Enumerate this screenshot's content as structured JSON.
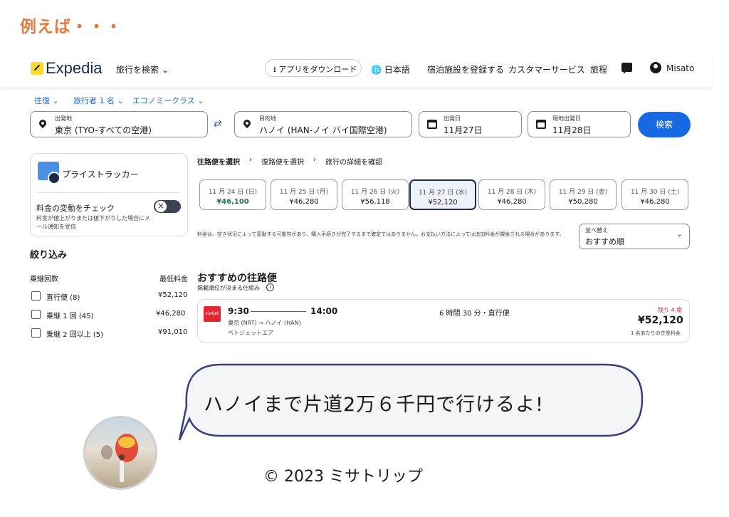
{
  "caption": "例えば・・・",
  "header": {
    "brand": "Expedia",
    "search_travel": "旅行を検索 ⌄",
    "app_download": "⭳ アプリをダウンロード",
    "language": "🌐 日本語",
    "register_property": "宿泊施設を登録する",
    "customer_service": "カスタマーサービス",
    "trips": "旅程",
    "user_name": "Misato"
  },
  "selectors": {
    "trip_type": "往復 ⌄",
    "travelers": "旅行者 1 名 ⌄",
    "cabin": "エコノミークラス ⌄"
  },
  "search": {
    "origin_label": "出発地",
    "origin_value": "東京 (TYO-すべての空港)",
    "destination_label": "目的地",
    "destination_value": "ハノイ (HAN-ノイ バイ国際空港)",
    "depart_label": "出発日",
    "depart_value": "11月27日",
    "return_label": "現地出発日",
    "return_value": "11月28日",
    "search_button": "検索",
    "swap_glyph": "⇄"
  },
  "price_tracker": {
    "title": "プライストラッカー",
    "subtitle": "料金の変動をチェック",
    "description": "料金が値上がりまたは値下がりした場合にメール通知を受信",
    "enabled": false
  },
  "filters": {
    "title": "絞り込み",
    "stops_header": "乗継回数",
    "min_price_header": "最低料金",
    "options": [
      {
        "label": "直行便 (8)",
        "price": "¥52,120"
      },
      {
        "label": "乗継 1 回 (45)",
        "price": "¥46,280"
      },
      {
        "label": "乗継 2 回以上 (5)",
        "price": "¥91,010"
      }
    ]
  },
  "breadcrumbs": {
    "step1": "往路便を選択",
    "step2": "復路便を選択",
    "step3": "旅行の詳細を確認",
    "sep": "›"
  },
  "dates": [
    {
      "date": "11 月 24 日 (日)",
      "price": "¥46,100",
      "lowest": true
    },
    {
      "date": "11 月 25 日 (月)",
      "price": "¥46,280"
    },
    {
      "date": "11 月 26 日 (火)",
      "price": "¥56,118"
    },
    {
      "date": "11 月 27 日 (水)",
      "price": "¥52,120",
      "selected": true
    },
    {
      "date": "11 月 28 日 (木)",
      "price": "¥46,280"
    },
    {
      "date": "11 月 29 日 (金)",
      "price": "¥50,280"
    },
    {
      "date": "11 月 30 日 (土)",
      "price": "¥46,280"
    }
  ],
  "notice": "料金は、空き状況によって変動する可能性があり、購入手続きが完了するまで確定ではありません。お支払い方法によっては追加料金が課金される場合があります。",
  "sort": {
    "label": "並べ替え",
    "value": "おすすめ順"
  },
  "recommended": {
    "title": "おすすめの往路便",
    "subtitle": "掲載順位が決まる仕組み"
  },
  "flight": {
    "airline_logo_text": "vietjet",
    "depart_time": "9:30",
    "arrive_time": "14:00",
    "route": "東京 (NRT) → ハノイ (HAN)",
    "airline": "ベトジェットエア",
    "duration": "6 時間 30 分・直行便",
    "seats_left": "残り 4 席",
    "price": "¥52,120",
    "price_note": "1 名あたりの往復料金"
  },
  "bubble": "ハノイまで片道2万６千円で行けるよ!",
  "copyright": "© 2023 ミサトリップ",
  "colors": {
    "accent": "#1668e3",
    "caption": "#e27a3f",
    "lowest_price": "#227950",
    "seats_warning": "#c81f44",
    "bubble_border": "#3a3f7a"
  }
}
